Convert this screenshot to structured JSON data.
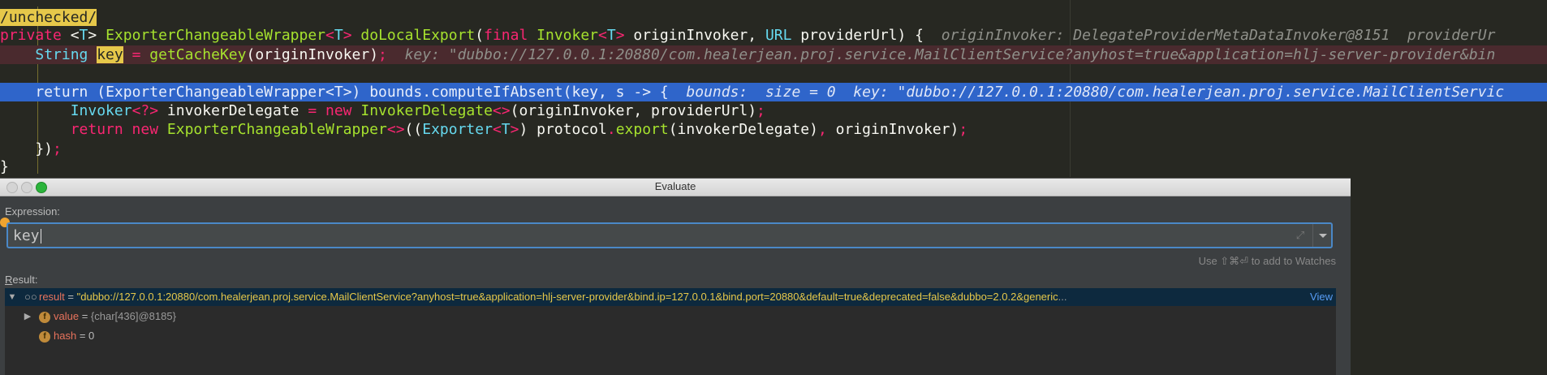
{
  "editor": {
    "lines": [
      [
        {
          "c": "ann",
          "t": "/unchecked/"
        }
      ],
      [
        {
          "c": "kw",
          "t": "private "
        },
        {
          "c": "pl",
          "t": "<"
        },
        {
          "c": "cl",
          "t": "T"
        },
        {
          "c": "pl",
          "t": "> "
        },
        {
          "c": "ty",
          "t": "ExporterChangeableWrapper"
        },
        {
          "c": "kw",
          "t": "<"
        },
        {
          "c": "cl",
          "t": "T"
        },
        {
          "c": "kw",
          "t": ">"
        },
        {
          "c": "pl",
          "t": " "
        },
        {
          "c": "fn",
          "t": "doLocalExport"
        },
        {
          "c": "pl",
          "t": "("
        },
        {
          "c": "kw",
          "t": "final "
        },
        {
          "c": "ty",
          "t": "Invoker"
        },
        {
          "c": "kw",
          "t": "<"
        },
        {
          "c": "cl",
          "t": "T"
        },
        {
          "c": "kw",
          "t": ">"
        },
        {
          "c": "pl",
          "t": " originInvoker, "
        },
        {
          "c": "cl",
          "t": "URL"
        },
        {
          "c": "pl",
          "t": " providerUrl) {  "
        },
        {
          "c": "inl",
          "t": "originInvoker: DelegateProviderMetaDataInvoker@8151  providerUr"
        }
      ],
      [
        {
          "c": "pl",
          "t": "    "
        },
        {
          "c": "cl",
          "t": "String "
        },
        {
          "c": "hl",
          "t": "key"
        },
        {
          "c": "pl",
          "t": " "
        },
        {
          "c": "kw",
          "t": "="
        },
        {
          "c": "pl",
          "t": " "
        },
        {
          "c": "fn",
          "t": "getCacheKey"
        },
        {
          "c": "pl",
          "t": "(originInvoker)"
        },
        {
          "c": "kw",
          "t": ";"
        },
        {
          "c": "pl",
          "t": "  "
        },
        {
          "c": "inl",
          "t": "key: \"dubbo://127.0.0.1:20880/com.healerjean.proj.service.MailClientService?anyhost=true&application=hlj-server-provider&bin"
        }
      ],
      [
        {
          "c": "pl",
          "t": ""
        }
      ],
      [
        {
          "c": "pl",
          "t": "    "
        },
        {
          "c": "kw",
          "t": "return "
        },
        {
          "c": "pl",
          "t": "("
        },
        {
          "c": "ty",
          "t": "ExporterChangeableWrapper"
        },
        {
          "c": "kw",
          "t": "<"
        },
        {
          "c": "ty",
          "t": "T"
        },
        {
          "c": "kw",
          "t": ">"
        },
        {
          "c": "pl",
          "t": ") bounds"
        },
        {
          "c": "kw",
          "t": "."
        },
        {
          "c": "fn",
          "t": "computeIfAbsent"
        },
        {
          "c": "pl",
          "t": "(key"
        },
        {
          "c": "kw",
          "t": ","
        },
        {
          "c": "pl",
          "t": " s "
        },
        {
          "c": "kw",
          "t": "->"
        },
        {
          "c": "pl",
          "t": " {  "
        },
        {
          "c": "inl",
          "t": "bounds:  size = 0  key: \"dubbo://127.0.0.1:20880/com.healerjean.proj.service.MailClientServic"
        }
      ],
      [
        {
          "c": "pl",
          "t": "        "
        },
        {
          "c": "cl",
          "t": "Invoker"
        },
        {
          "c": "kw",
          "t": "<?>"
        },
        {
          "c": "pl",
          "t": " invokerDelegate "
        },
        {
          "c": "kw",
          "t": "="
        },
        {
          "c": "pl",
          "t": " "
        },
        {
          "c": "kw",
          "t": "new "
        },
        {
          "c": "ty",
          "t": "InvokerDelegate"
        },
        {
          "c": "kw",
          "t": "<>"
        },
        {
          "c": "pl",
          "t": "(originInvoker, providerUrl)"
        },
        {
          "c": "kw",
          "t": ";"
        }
      ],
      [
        {
          "c": "pl",
          "t": "        "
        },
        {
          "c": "kw",
          "t": "return new "
        },
        {
          "c": "ty",
          "t": "ExporterChangeableWrapper"
        },
        {
          "c": "kw",
          "t": "<>"
        },
        {
          "c": "pl",
          "t": "(("
        },
        {
          "c": "cl",
          "t": "Exporter"
        },
        {
          "c": "kw",
          "t": "<"
        },
        {
          "c": "cl",
          "t": "T"
        },
        {
          "c": "kw",
          "t": ">"
        },
        {
          "c": "pl",
          "t": ") protocol"
        },
        {
          "c": "kw",
          "t": "."
        },
        {
          "c": "fn",
          "t": "export"
        },
        {
          "c": "pl",
          "t": "(invokerDelegate)"
        },
        {
          "c": "kw",
          "t": ","
        },
        {
          "c": "pl",
          "t": " originInvoker)"
        },
        {
          "c": "kw",
          "t": ";"
        }
      ],
      [
        {
          "c": "pl",
          "t": "    })"
        },
        {
          "c": "kw",
          "t": ";"
        }
      ],
      [
        {
          "c": "pl",
          "t": "}"
        }
      ]
    ]
  },
  "dialog": {
    "title": "Evaluate",
    "expression_label": "Expression:",
    "expression_value": "key",
    "hint": "Use ⇧⌘⏎ to add to Watches",
    "result_label_first": "R",
    "result_label_rest": "esult:",
    "result": {
      "name": "result",
      "value": "\"dubbo://127.0.0.1:20880/com.healerjean.proj.service.MailClientService?anyhost=true&application=hlj-server-provider&bind.ip=127.0.0.1&bind.port=20880&default=true&deprecated=false&dubbo=2.0.2&generic",
      "ellipsis": "...",
      "view_label": "View"
    },
    "children": [
      {
        "name": "value",
        "value": "{char[436]@8185}",
        "expandable": true
      },
      {
        "name": "hash",
        "value": "0",
        "expandable": false
      }
    ]
  }
}
